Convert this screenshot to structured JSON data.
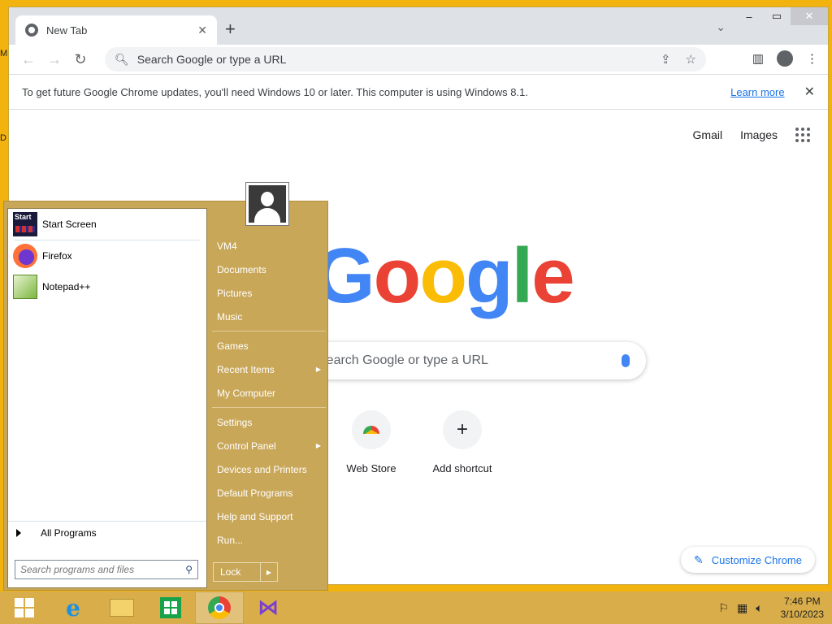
{
  "desktop": {
    "labels": [
      "M",
      "D"
    ]
  },
  "browser": {
    "tab_title": "New Tab",
    "newtab_label": "+",
    "omnibox_placeholder": "Search Google or type a URL",
    "infobar": {
      "message": "To get future Google Chrome updates, you'll need Windows 10 or later. This computer is using Windows 8.1.",
      "link": "Learn more"
    },
    "toplinks": {
      "gmail": "Gmail",
      "images": "Images"
    },
    "logo": [
      "G",
      "o",
      "o",
      "g",
      "l",
      "e"
    ],
    "searchbox_text": "Search Google or type a URL",
    "shortcuts": [
      {
        "label": "Web Store",
        "icon": "webstore-icon"
      },
      {
        "label": "Add shortcut",
        "icon": "plus-icon"
      }
    ],
    "customize_label": "Customize Chrome"
  },
  "start_menu": {
    "pinned": [
      {
        "label": "Start Screen",
        "icon": "start-screen-icon"
      },
      {
        "label": "Firefox",
        "icon": "firefox-icon"
      },
      {
        "label": "Notepad++",
        "icon": "notepadpp-icon"
      }
    ],
    "all_programs": "All Programs",
    "search_placeholder": "Search programs and files",
    "right_items": [
      {
        "label": "VM4"
      },
      {
        "label": "Documents"
      },
      {
        "label": "Pictures"
      },
      {
        "label": "Music"
      },
      {
        "label": "Games"
      },
      {
        "label": "Recent Items",
        "arrow": true
      },
      {
        "label": "My Computer"
      },
      {
        "label": "Settings"
      },
      {
        "label": "Control Panel",
        "arrow": true
      },
      {
        "label": "Devices and Printers"
      },
      {
        "label": "Default Programs"
      },
      {
        "label": "Help and Support"
      },
      {
        "label": "Run..."
      }
    ],
    "lock_label": "Lock"
  },
  "taskbar": {
    "apps": [
      "start-button",
      "internet-explorer",
      "file-explorer",
      "store",
      "chrome",
      "visual-studio"
    ],
    "time": "7:46 PM",
    "date": "3/10/2023"
  },
  "colors": {
    "desktop": "#f3b30f",
    "start_menu": "#c9a758",
    "taskbar": "#d8ad4a",
    "link": "#1a73e8"
  }
}
